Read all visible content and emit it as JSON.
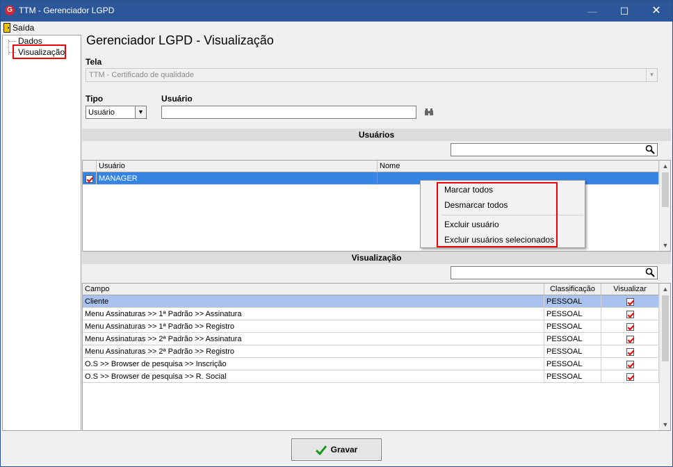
{
  "window": {
    "title": "TTM - Gerenciador LGPD",
    "icon": "app-logo-icon"
  },
  "menu": {
    "exit_label": "Saída"
  },
  "tree": {
    "items": [
      {
        "label": "Dados"
      },
      {
        "label": "Visualização"
      }
    ]
  },
  "page": {
    "title": "Gerenciador LGPD - Visualização"
  },
  "form": {
    "tela_label": "Tela",
    "tela_value": "TTM - Certificado de qualidade",
    "tipo_label": "Tipo",
    "tipo_value": "Usuário",
    "usuario_label": "Usuário",
    "usuario_value": ""
  },
  "users_section": {
    "title": "Usuários",
    "search_value": "",
    "columns": [
      "Usuário",
      "Nome"
    ],
    "rows": [
      {
        "checked": true,
        "usuario": "MANAGER",
        "nome": ""
      }
    ]
  },
  "context_menu": {
    "items": [
      "Marcar todos",
      "Desmarcar todos",
      "Excluir usuário",
      "Excluir usuários selecionados"
    ]
  },
  "view_section": {
    "title": "Visualização",
    "search_value": "",
    "columns": [
      "Campo",
      "Classificação",
      "Visualizar"
    ],
    "rows": [
      {
        "campo": "Cliente",
        "classificacao": "PESSOAL",
        "visualizar": true
      },
      {
        "campo": "Menu Assinaturas >> 1ª Padrão >> Assinatura",
        "classificacao": "PESSOAL",
        "visualizar": true
      },
      {
        "campo": "Menu Assinaturas >> 1ª Padrão >> Registro",
        "classificacao": "PESSOAL",
        "visualizar": true
      },
      {
        "campo": "Menu Assinaturas >> 2ª Padrão >> Assinatura",
        "classificacao": "PESSOAL",
        "visualizar": true
      },
      {
        "campo": "Menu Assinaturas >> 2ª Padrão >> Registro",
        "classificacao": "PESSOAL",
        "visualizar": true
      },
      {
        "campo": "O.S >> Browser de pesquisa >> Inscrição",
        "classificacao": "PESSOAL",
        "visualizar": true
      },
      {
        "campo": "O.S >> Browser de pesquisa >> R. Social",
        "classificacao": "PESSOAL",
        "visualizar": true
      }
    ]
  },
  "footer": {
    "save_label": "Gravar"
  },
  "colors": {
    "titlebar": "#2b579a",
    "selection": "#3584e4",
    "highlight": "#e00000"
  }
}
